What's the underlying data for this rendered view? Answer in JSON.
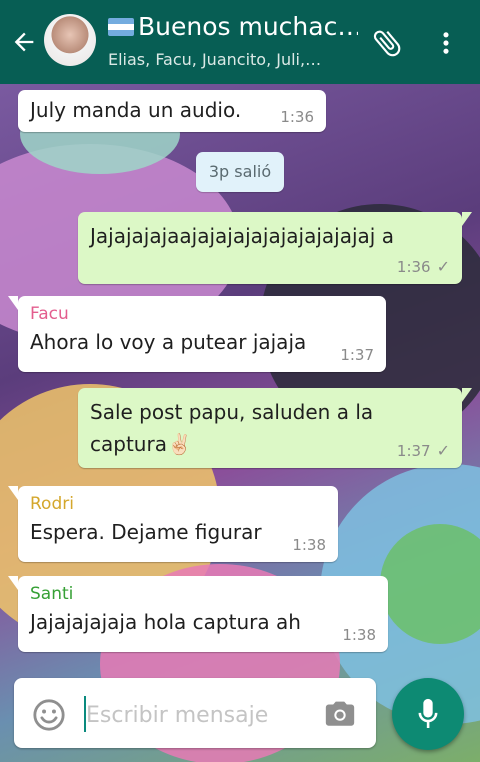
{
  "header": {
    "title": "Buenos muchac…",
    "subtitle": "Elias, Facu, Juancito, Juli,…"
  },
  "messages": [
    {
      "type": "in",
      "sender": "",
      "text": "July manda un audio.",
      "time": "1:36"
    },
    {
      "type": "system",
      "text": "3p salió"
    },
    {
      "type": "out",
      "text": "Jajajajajaajajajajajajajajajajaj a",
      "time": "1:36",
      "status": "✓"
    },
    {
      "type": "in",
      "sender": "Facu",
      "sender_color": "#e35d8e",
      "text": "Ahora lo voy a putear jajaja",
      "time": "1:37"
    },
    {
      "type": "out",
      "text": "Sale post papu, saluden a la captura✌🏻",
      "time": "1:37",
      "status": "✓"
    },
    {
      "type": "in",
      "sender": "Rodri",
      "sender_color": "#d4a72c",
      "text": "Espera. Dejame figurar",
      "time": "1:38"
    },
    {
      "type": "in",
      "sender": "Santi",
      "sender_color": "#36a035",
      "text": "Jajajajajaja hola captura ah",
      "time": "1:38"
    }
  ],
  "composer": {
    "placeholder": "Escribir mensaje"
  },
  "colors": {
    "appbar": "#075e54",
    "outgoing_bubble": "#dcf8c6",
    "incoming_bubble": "#ffffff",
    "mic_button": "#0d8a73"
  },
  "icons": {
    "back": "arrow-left-icon",
    "attach": "paperclip-icon",
    "menu": "more-vert-icon",
    "emoji": "smiley-icon",
    "camera": "camera-icon",
    "mic": "mic-icon"
  }
}
